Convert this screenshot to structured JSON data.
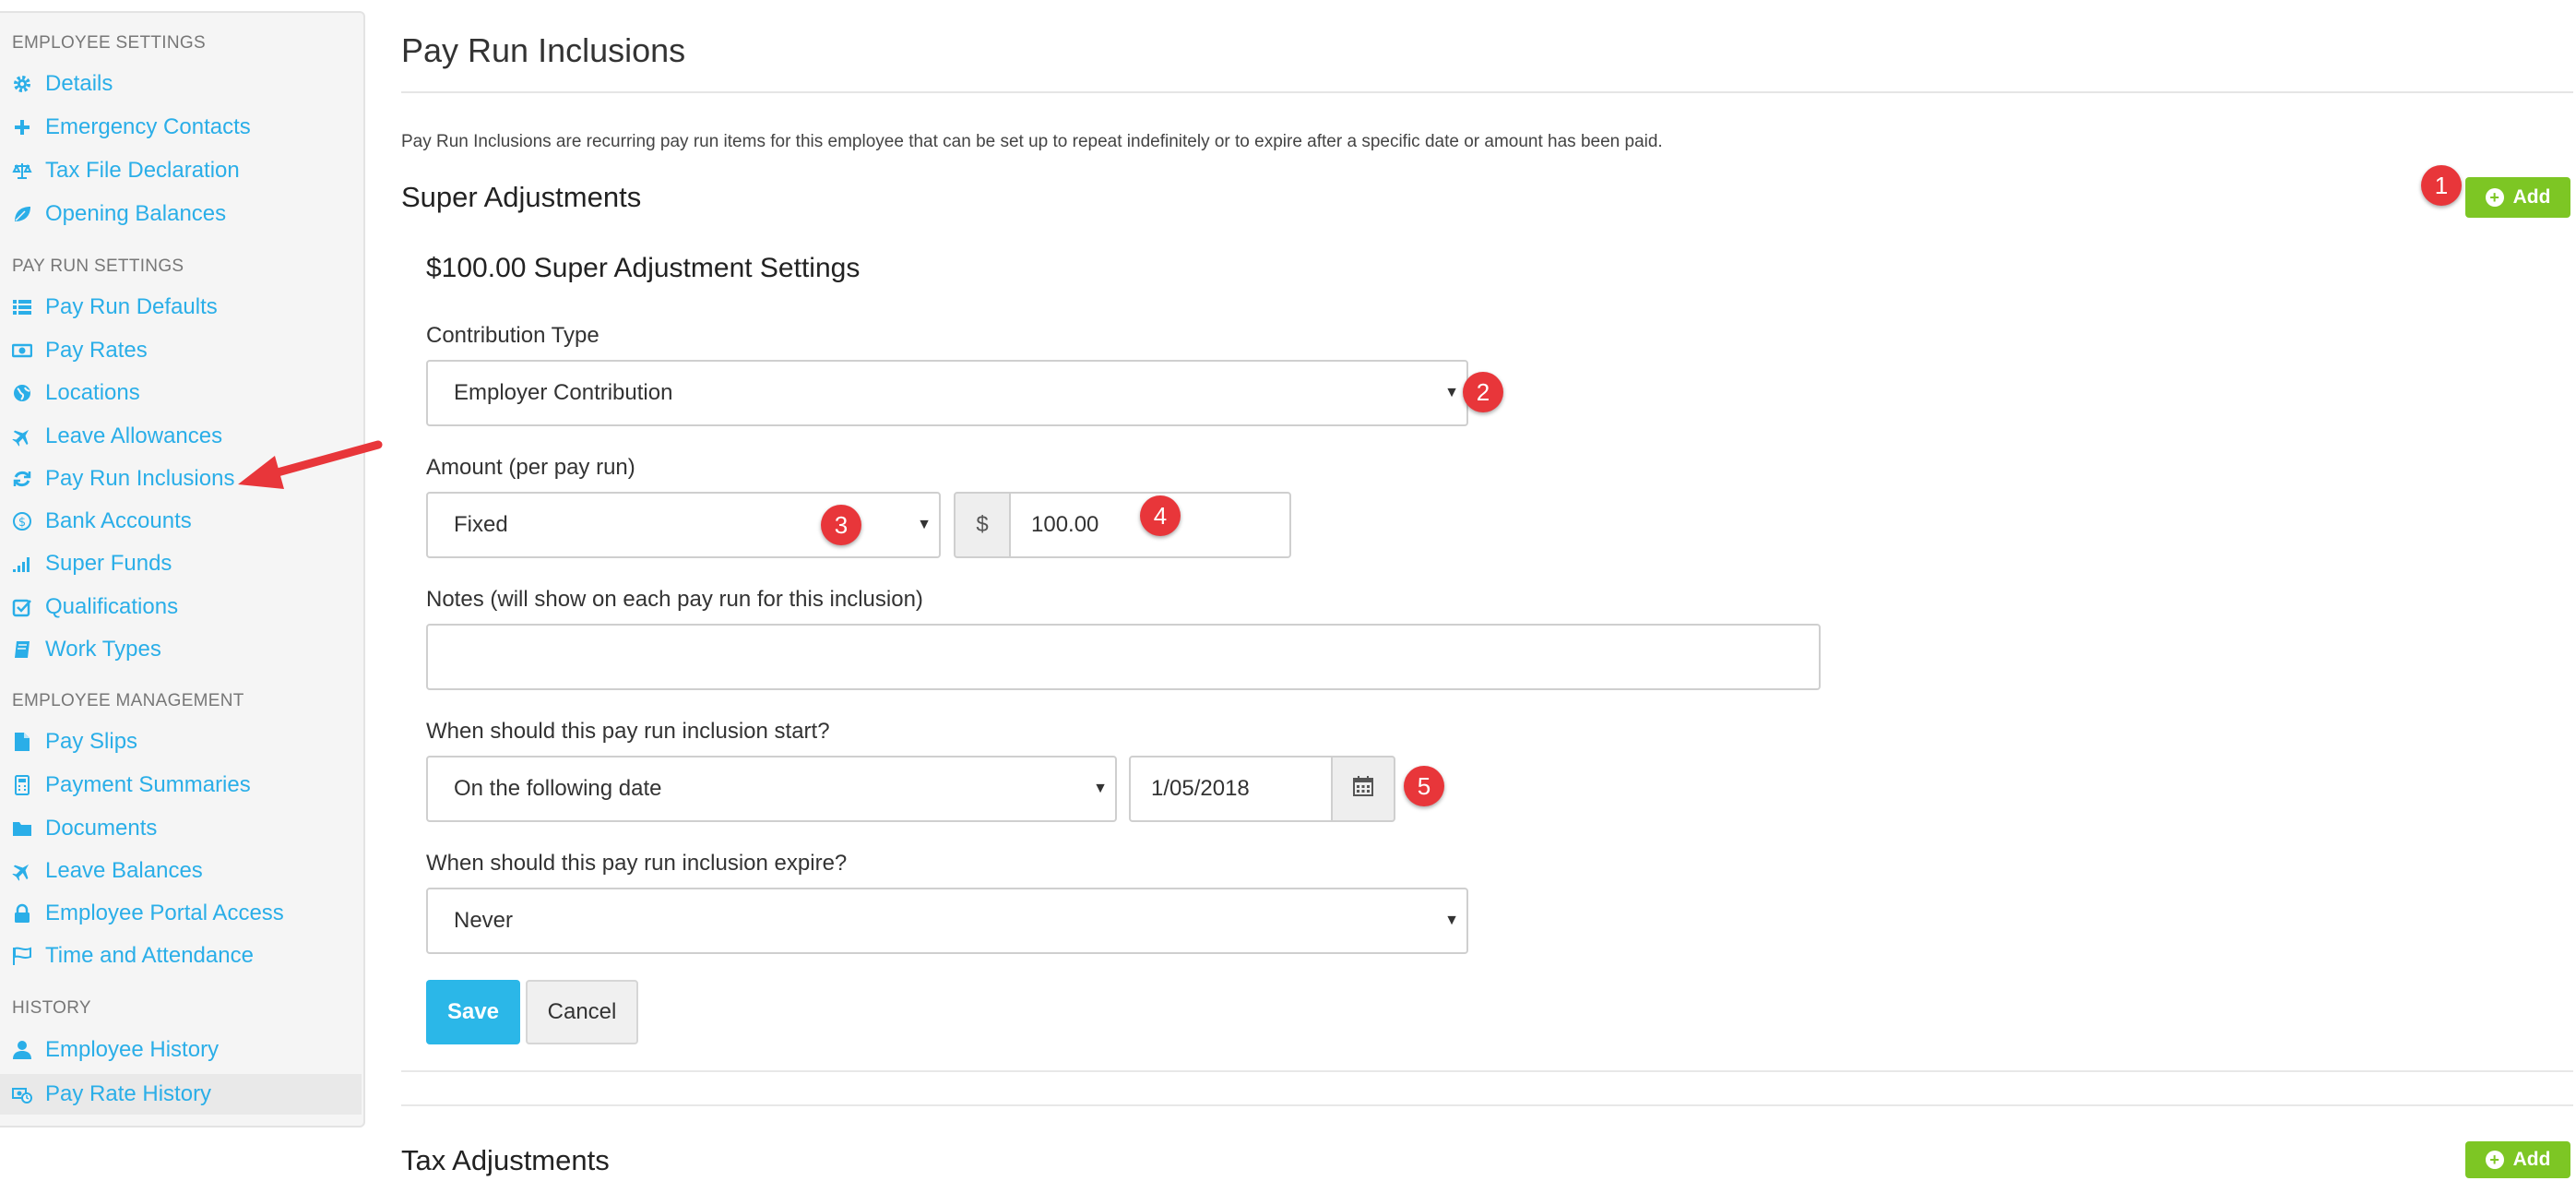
{
  "sidebar": {
    "sections": [
      {
        "title": "EMPLOYEE SETTINGS",
        "items": [
          {
            "label": "Details",
            "icon": "gear-icon"
          },
          {
            "label": "Emergency Contacts",
            "icon": "plus-icon"
          },
          {
            "label": "Tax File Declaration",
            "icon": "scales-icon"
          },
          {
            "label": "Opening Balances",
            "icon": "leaf-icon"
          }
        ]
      },
      {
        "title": "PAY RUN SETTINGS",
        "items": [
          {
            "label": "Pay Run Defaults",
            "icon": "list-icon"
          },
          {
            "label": "Pay Rates",
            "icon": "banknote-icon"
          },
          {
            "label": "Locations",
            "icon": "globe-icon"
          },
          {
            "label": "Leave Allowances",
            "icon": "plane-icon"
          },
          {
            "label": "Pay Run Inclusions",
            "icon": "refresh-icon"
          },
          {
            "label": "Bank Accounts",
            "icon": "dollar-circle-icon"
          },
          {
            "label": "Super Funds",
            "icon": "signal-bars-icon"
          },
          {
            "label": "Qualifications",
            "icon": "checkbox-icon"
          },
          {
            "label": "Work Types",
            "icon": "book-icon"
          }
        ]
      },
      {
        "title": "EMPLOYEE MANAGEMENT",
        "items": [
          {
            "label": "Pay Slips",
            "icon": "file-icon"
          },
          {
            "label": "Payment Summaries",
            "icon": "calculator-icon"
          },
          {
            "label": "Documents",
            "icon": "folder-icon"
          },
          {
            "label": "Leave Balances",
            "icon": "plane-icon"
          },
          {
            "label": "Employee Portal Access",
            "icon": "lock-icon"
          },
          {
            "label": "Time and Attendance",
            "icon": "flags-icon"
          }
        ]
      },
      {
        "title": "HISTORY",
        "items": [
          {
            "label": "Employee History",
            "icon": "user-icon"
          },
          {
            "label": "Pay Rate History",
            "icon": "money-history-icon"
          }
        ]
      }
    ]
  },
  "page": {
    "title": "Pay Run Inclusions",
    "intro": "Pay Run Inclusions are recurring pay run items for this employee that can be set up to repeat indefinitely or to expire after a specific date or amount has been paid."
  },
  "super_adjustments": {
    "title": "Super Adjustments",
    "add_label": "Add",
    "form": {
      "heading": "$100.00 Super Adjustment Settings",
      "contribution_type_label": "Contribution Type",
      "contribution_type_value": "Employer Contribution",
      "amount_label": "Amount (per pay run)",
      "amount_type_value": "Fixed",
      "currency_symbol": "$",
      "amount_value": "100.00",
      "notes_label": "Notes (will show on each pay run for this inclusion)",
      "notes_value": "",
      "start_label": "When should this pay run inclusion start?",
      "start_value": "On the following date",
      "start_date": "1/05/2018",
      "expire_label": "When should this pay run inclusion expire?",
      "expire_value": "Never",
      "save_label": "Save",
      "cancel_label": "Cancel"
    }
  },
  "tax_adjustments": {
    "title": "Tax Adjustments",
    "add_label": "Add"
  },
  "markers": [
    "1",
    "2",
    "3",
    "4",
    "5"
  ],
  "colors": {
    "link": "#2aaee8",
    "add_button": "#7dc624",
    "save_button": "#2bb7e8",
    "marker": "#e8363a",
    "arrow": "#e8363a"
  }
}
